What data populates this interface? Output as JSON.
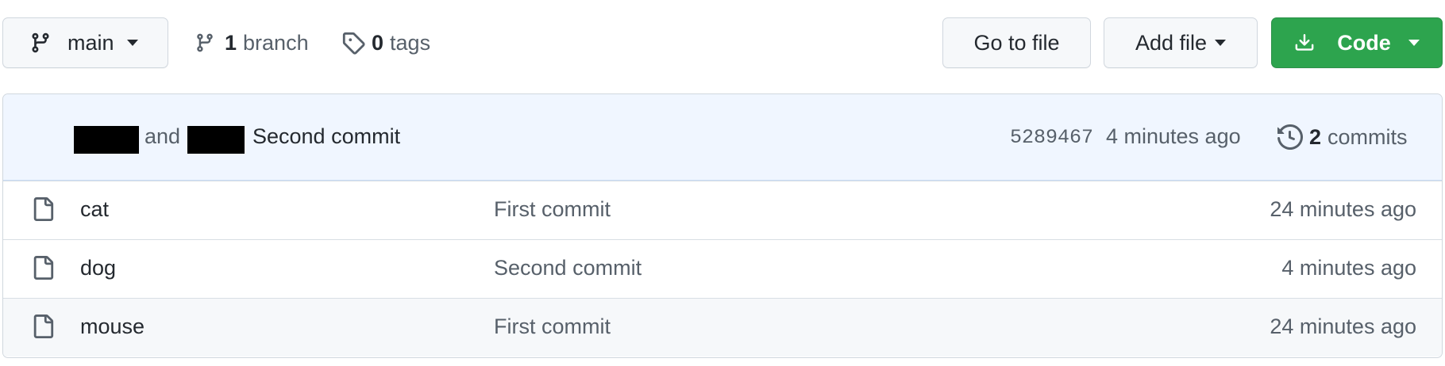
{
  "toolbar": {
    "branch_button_label": "main",
    "branches_count": "1",
    "branches_label": "branch",
    "tags_count": "0",
    "tags_label": "tags",
    "goto_file_label": "Go to file",
    "add_file_label": "Add file",
    "code_label": "Code",
    "code_button_color": "#2da44e"
  },
  "latest_commit": {
    "joiner": "and",
    "message": "Second commit",
    "sha": "5289467",
    "age": "4 minutes ago",
    "commits_count": "2",
    "commits_label": "commits",
    "header_bg": "#f0f6ff"
  },
  "files": [
    {
      "name": "cat",
      "message": "First commit",
      "age": "24 minutes ago",
      "icon": "file-icon"
    },
    {
      "name": "dog",
      "message": "Second commit",
      "age": "4 minutes ago",
      "icon": "file-icon"
    },
    {
      "name": "mouse",
      "message": "First commit",
      "age": "24 minutes ago",
      "icon": "file-icon"
    }
  ]
}
